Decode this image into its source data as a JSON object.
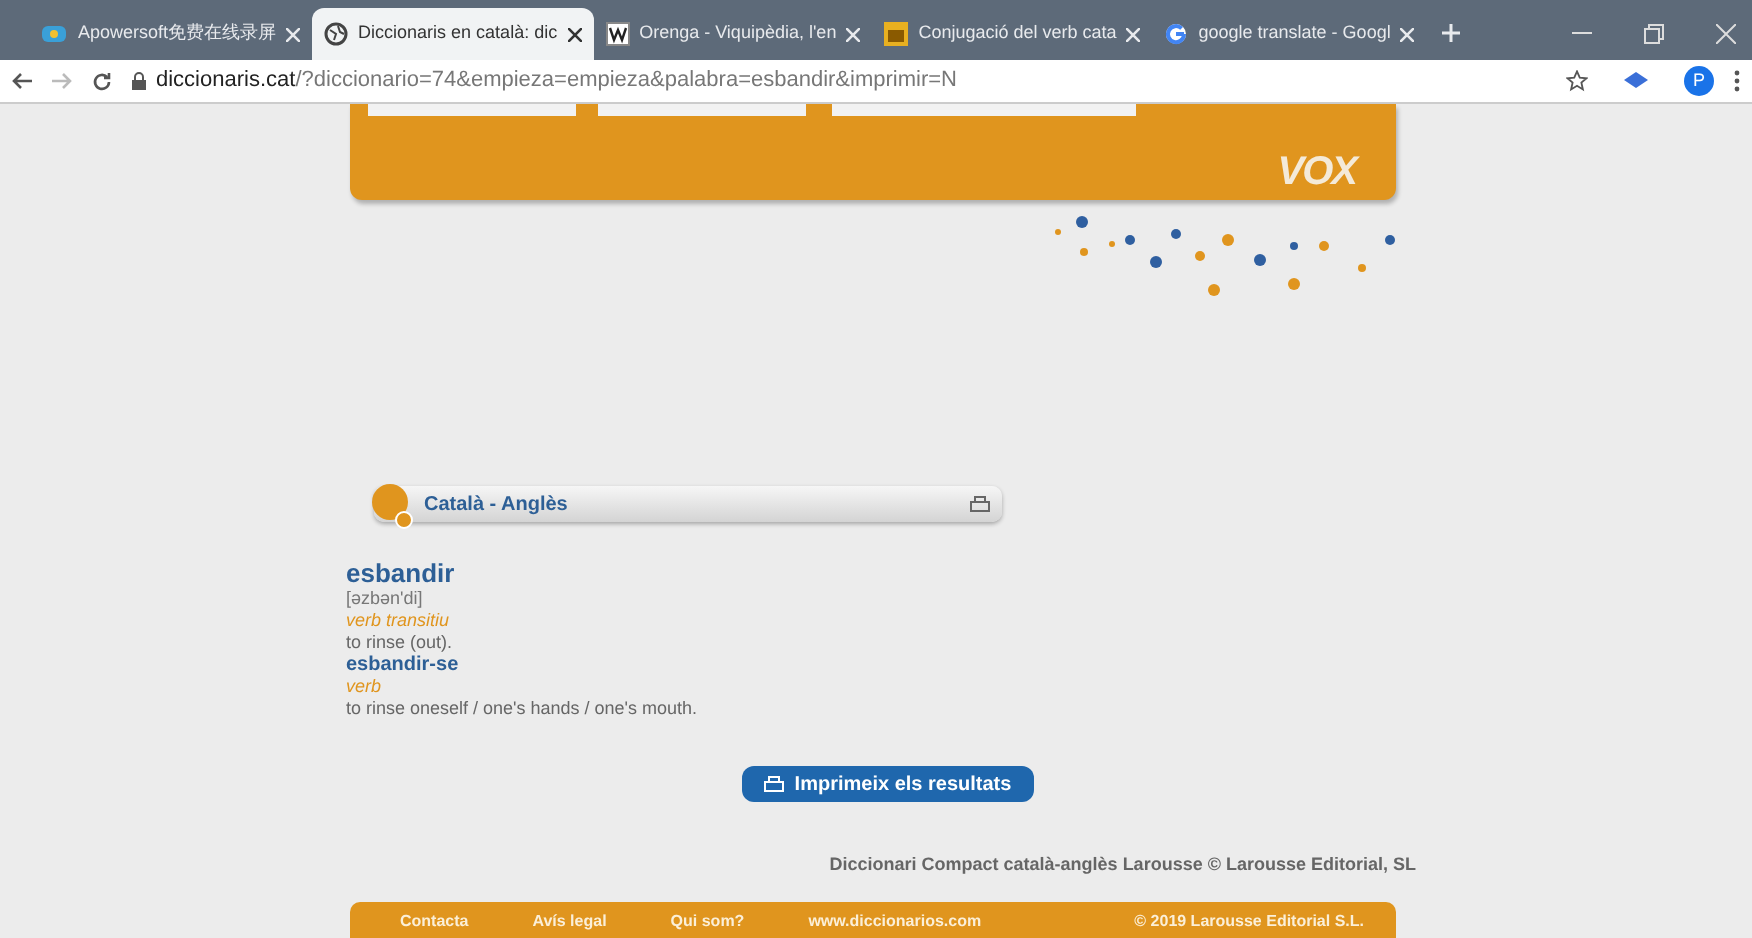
{
  "tabs": [
    {
      "title": "Apowersoft免费在线录屏",
      "selected": false
    },
    {
      "title": "Diccionaris en català: dic",
      "selected": true
    },
    {
      "title": "Orenga - Viquipèdia, l'en",
      "selected": false
    },
    {
      "title": "Conjugació del verb cata",
      "selected": false
    },
    {
      "title": "google translate - Googl",
      "selected": false
    }
  ],
  "address": {
    "host": "diccionaris.cat",
    "path": "/?diccionario=74&empieza=empieza&palabra=esbandir&imprimir=N"
  },
  "profile": "P",
  "header": {
    "logo": "VOX"
  },
  "panel": {
    "title": "Català - Anglès"
  },
  "entry": [
    {
      "kind": "headword",
      "text": "esbandir"
    },
    {
      "kind": "phonetic",
      "text": "[əzbən'di]"
    },
    {
      "kind": "category",
      "text": "verb transitiu"
    },
    {
      "kind": "definition",
      "text": "to rinse (out)."
    },
    {
      "kind": "subword",
      "text": "esbandir-se"
    },
    {
      "kind": "category",
      "text": "verb"
    },
    {
      "kind": "definition",
      "text": "to rinse oneself / one's hands / one's mouth."
    }
  ],
  "print_button": "Imprimeix els resultats",
  "credit": "Diccionari Compact català-anglès Larousse © Larousse Editorial, SL",
  "footer": {
    "links": [
      "Contacta",
      "Avís legal",
      "Qui som?",
      "www.diccionarios.com"
    ],
    "copyright": "© 2019 Larousse Editorial S.L."
  }
}
